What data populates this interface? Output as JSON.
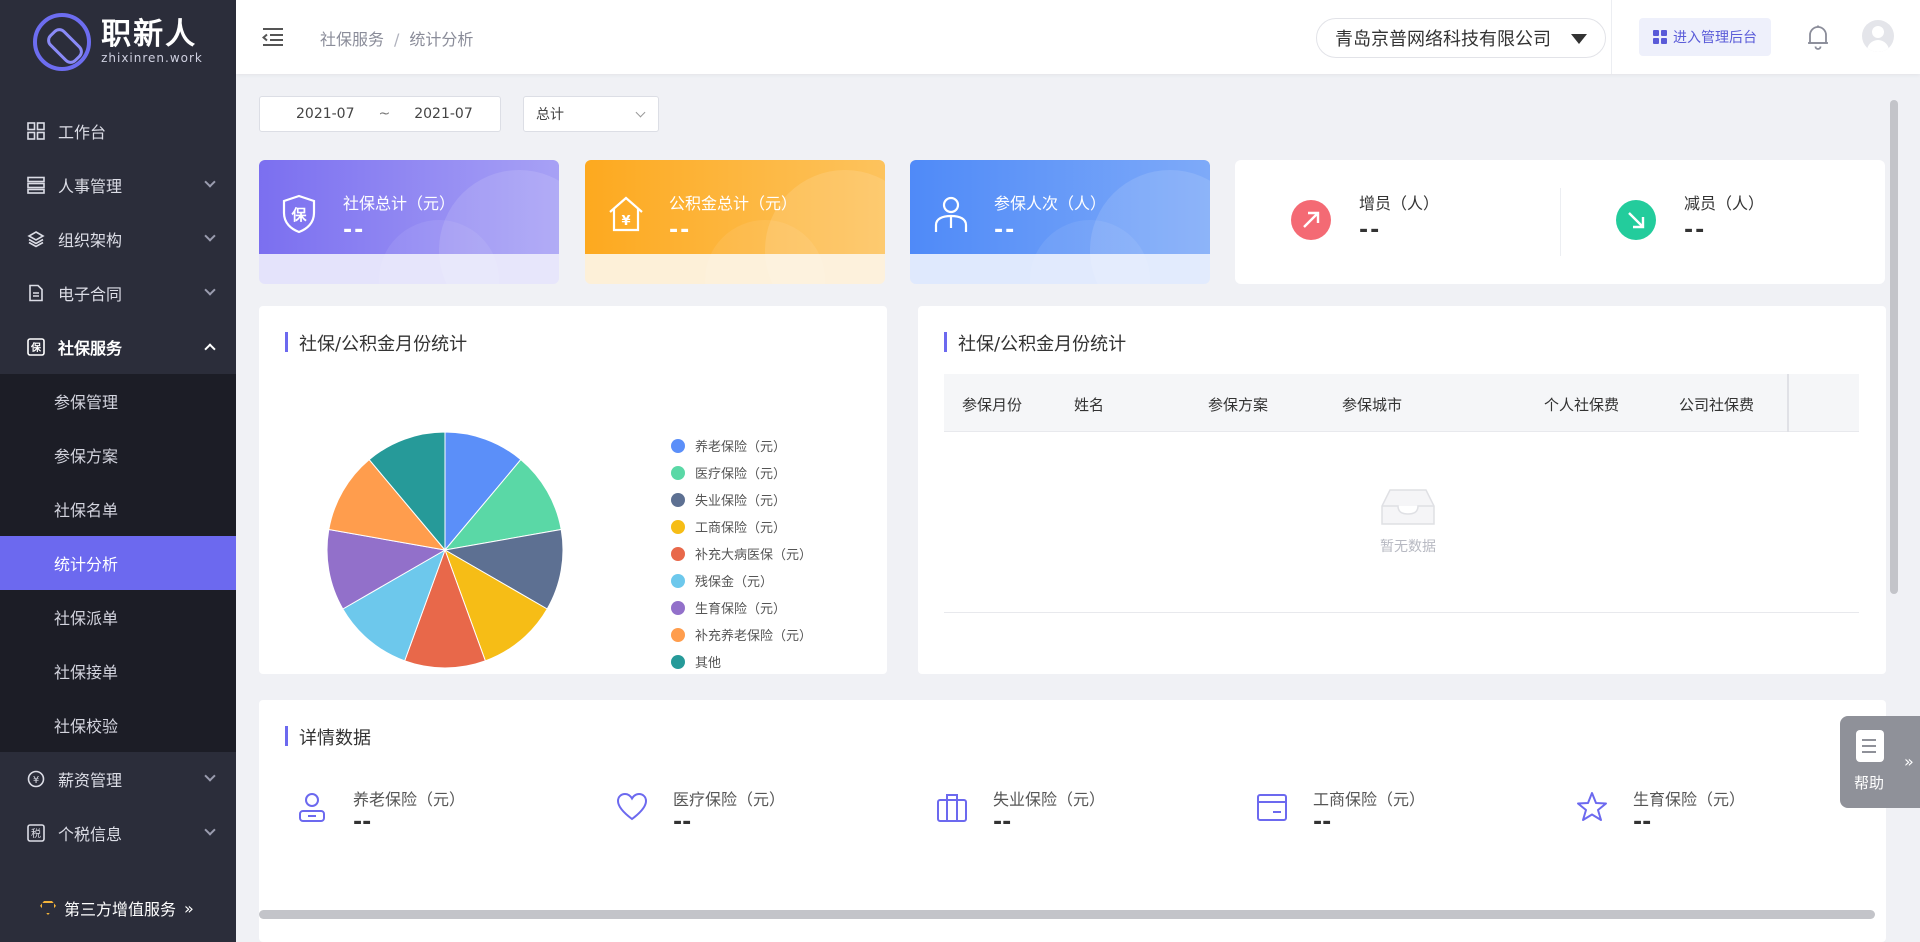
{
  "logo": {
    "cn": "职新人",
    "en": "zhixinren.work"
  },
  "sidebar": {
    "items": [
      {
        "label": "工作台",
        "icon": "dashboard-icon"
      },
      {
        "label": "人事管理",
        "icon": "personnel-icon"
      },
      {
        "label": "组织架构",
        "icon": "layers-icon"
      },
      {
        "label": "电子合同",
        "icon": "document-icon"
      },
      {
        "label": "社保服务",
        "icon": "social-security-icon"
      },
      {
        "label": "薪资管理",
        "icon": "salary-icon"
      },
      {
        "label": "个税信息",
        "icon": "tax-icon"
      }
    ],
    "submenu": [
      "参保管理",
      "参保方案",
      "社保名单",
      "统计分析",
      "社保派单",
      "社保接单",
      "社保校验"
    ],
    "active_sub": "统计分析",
    "third_party": "第三方增值服务",
    "third_party_arrow": "»"
  },
  "header": {
    "breadcrumb": [
      "社保服务",
      "统计分析"
    ],
    "breadcrumb_sep": "/",
    "company": "青岛京普网络科技有限公司",
    "admin_button": "进入管理后台"
  },
  "filters": {
    "date_start": "2021-07",
    "date_sep": "~",
    "date_end": "2021-07",
    "select_value": "总计"
  },
  "cards": [
    {
      "label": "社保总计（元）",
      "value": "--",
      "icon": "shield-icon",
      "icon_text": "保"
    },
    {
      "label": "公积金总计（元）",
      "value": "--",
      "icon": "house-yuan-icon",
      "icon_text": "¥"
    },
    {
      "label": "参保人次（人）",
      "value": "--",
      "icon": "person-icon"
    }
  ],
  "change_card": {
    "increase_label": "增员（人）",
    "increase_value": "--",
    "decrease_label": "减员（人）",
    "decrease_value": "--"
  },
  "pie_panel": {
    "title": "社保/公积金月份统计"
  },
  "table_panel": {
    "title": "社保/公积金月份统计",
    "columns": [
      "参保月份",
      "姓名",
      "参保方案",
      "参保城市",
      "个人社保费",
      "公司社保费"
    ],
    "empty_text": "暂无数据"
  },
  "detail_panel": {
    "title": "详情数据",
    "items": [
      {
        "label": "养老保险（元）",
        "value": "--",
        "icon": "person-badge-icon"
      },
      {
        "label": "医疗保险（元）",
        "value": "--",
        "icon": "heart-icon"
      },
      {
        "label": "失业保险（元）",
        "value": "--",
        "icon": "briefcase-icon"
      },
      {
        "label": "工商保险（元）",
        "value": "--",
        "icon": "card-icon"
      },
      {
        "label": "生育保险（元）",
        "value": "--",
        "icon": "star-icon"
      }
    ]
  },
  "help": {
    "label": "帮助",
    "arrow": "»"
  },
  "colors": {
    "accent": "#6c69ef",
    "sidebar_bg": "#2b2d3a",
    "submenu_bg": "#1c1d26"
  },
  "chart_data": {
    "type": "pie",
    "categories": [
      "养老保险（元）",
      "医疗保险（元）",
      "失业保险（元）",
      "工商保险（元）",
      "补充大病医保（元）",
      "残保金（元）",
      "生育保险（元）",
      "补充养老保险（元）",
      "其他"
    ],
    "values": [
      1,
      1,
      1,
      1,
      1,
      1,
      1,
      1,
      1
    ],
    "colors": [
      "#5b8ff9",
      "#5ad8a6",
      "#5d7092",
      "#f6bd16",
      "#e8684a",
      "#6dc8ec",
      "#9270ca",
      "#ff9d4d",
      "#269a99"
    ],
    "legend_position": "right"
  }
}
